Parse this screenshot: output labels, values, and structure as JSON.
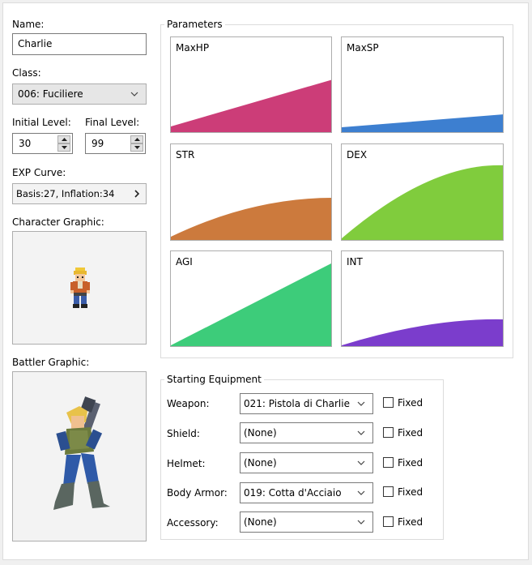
{
  "name": {
    "label": "Name:",
    "value": "Charlie"
  },
  "class": {
    "label": "Class:",
    "value": "006: Fuciliere"
  },
  "initial_level": {
    "label": "Initial Level:",
    "value": "30"
  },
  "final_level": {
    "label": "Final Level:",
    "value": "99"
  },
  "exp_curve": {
    "label": "EXP Curve:",
    "value": "Basis:27, Inflation:34"
  },
  "character_graphic": {
    "label": "Character Graphic:"
  },
  "battler_graphic": {
    "label": "Battler Graphic:"
  },
  "parameters": {
    "title": "Parameters",
    "items": [
      {
        "name": "MaxHP",
        "color": "#cc3d78"
      },
      {
        "name": "MaxSP",
        "color": "#3d7fd0"
      },
      {
        "name": "STR",
        "color": "#cc7a3d"
      },
      {
        "name": "DEX",
        "color": "#80cc3d"
      },
      {
        "name": "AGI",
        "color": "#3dcc7a"
      },
      {
        "name": "INT",
        "color": "#7b3dcc"
      }
    ]
  },
  "equipment": {
    "title": "Starting Equipment",
    "fixed_label": "Fixed",
    "slots": [
      {
        "label": "Weapon:",
        "value": "021: Pistola di Charlie",
        "fixed": false
      },
      {
        "label": "Shield:",
        "value": "(None)",
        "fixed": false
      },
      {
        "label": "Helmet:",
        "value": "(None)",
        "fixed": false
      },
      {
        "label": "Body Armor:",
        "value": "019: Cotta d'Acciaio",
        "fixed": false
      },
      {
        "label": "Accessory:",
        "value": "(None)",
        "fixed": false
      }
    ]
  },
  "icons": {
    "combo": "chevron-down-icon",
    "spin_up": "arrow-up-icon",
    "spin_down": "arrow-down-icon",
    "exp": "chevron-right-icon"
  }
}
